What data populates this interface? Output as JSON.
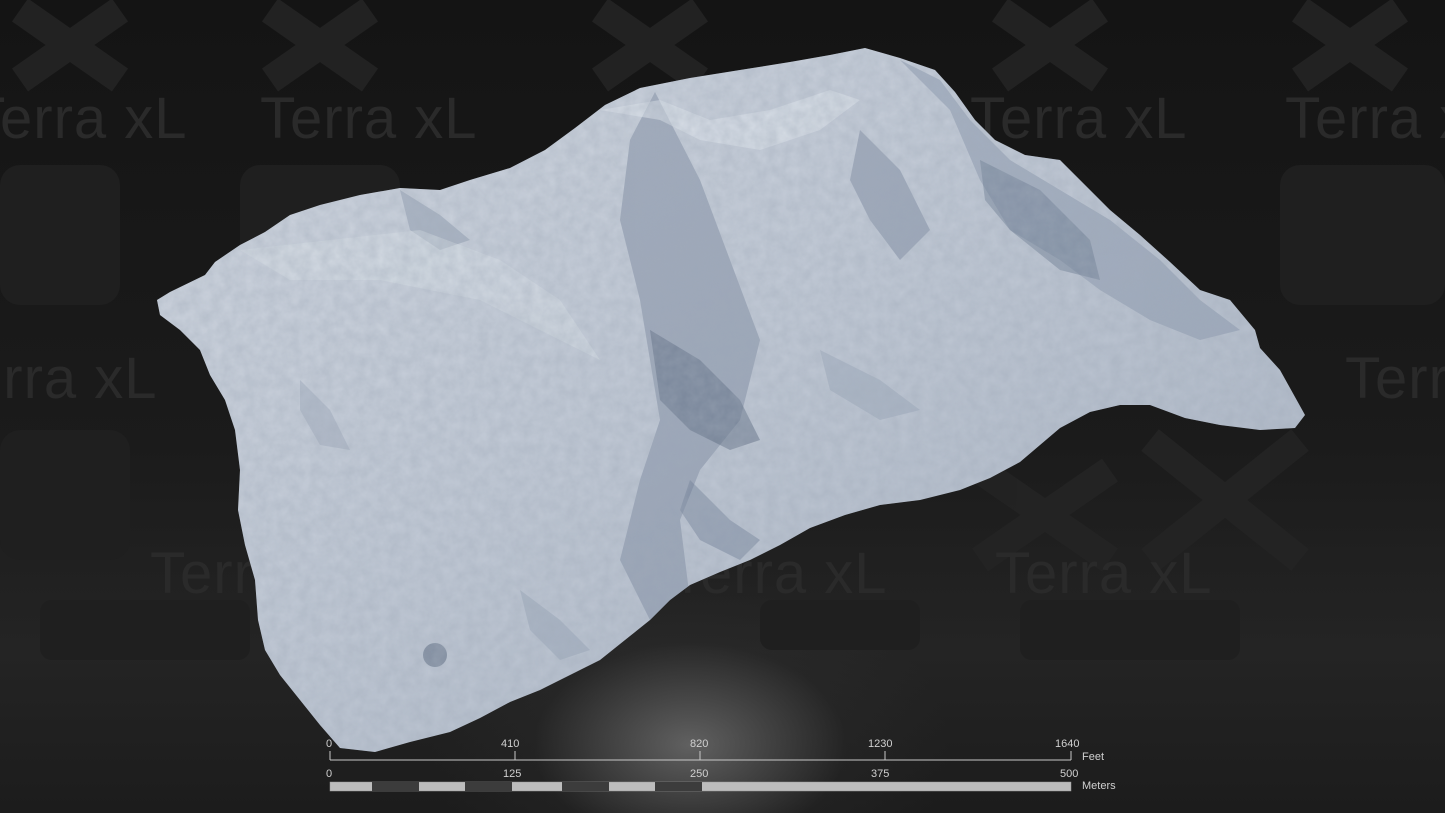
{
  "watermark": {
    "brand_text": "Terra xL",
    "color": "#2a2a2a"
  },
  "terrain": {
    "subject": "3D shaded relief terrain model",
    "base_color": "#c9d0db",
    "shadow_color": "#55657a"
  },
  "scale_bar": {
    "feet": {
      "ticks": [
        "0",
        "410",
        "820",
        "1230",
        "1640"
      ],
      "unit_label": "Feet"
    },
    "meters": {
      "ticks": [
        "0",
        "125",
        "250",
        "375",
        "500"
      ],
      "unit_label": "Meters"
    },
    "colors": {
      "line": "#c8c8c8",
      "light_segment": "#bdbdbd",
      "dark_segment": "#3c3c3c"
    }
  }
}
